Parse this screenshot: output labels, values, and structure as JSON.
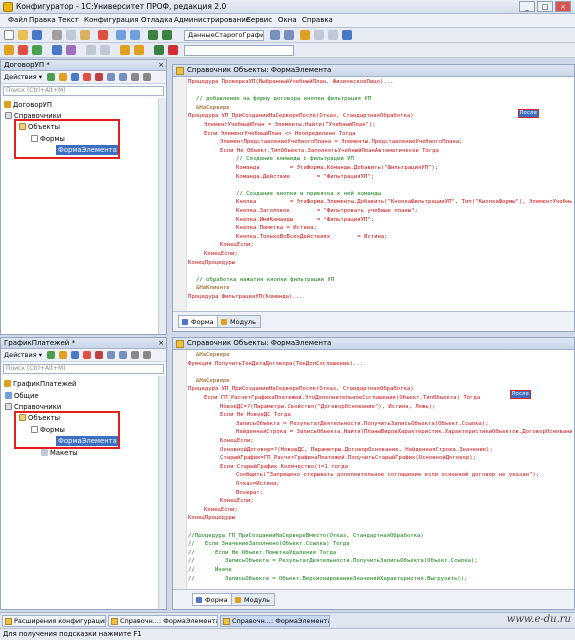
{
  "window": {
    "title": "Конфигуратор - 1С:Университет ПРОФ, редакция 2.0",
    "min": "_",
    "max": "□",
    "close": "×"
  },
  "menu": [
    "Файл",
    "Правка",
    "Текст",
    "Конфигурация",
    "Отладка",
    "Администрирование",
    "Сервис",
    "Окна",
    "Справка"
  ],
  "toolbar": {
    "combo_value": "ДанныеСтарогоГрафи",
    "combo2_value": ""
  },
  "panel1": {
    "title": "ДоговорУП *",
    "close": "×",
    "actions": "Действия ▾",
    "search_placeholder": "Поиск (Ctrl+Alt+M)",
    "tree": [
      "ДоговорУП",
      "Справочники",
      "Объекты",
      "Формы",
      "ФормаЭлемента"
    ]
  },
  "panel2": {
    "title": "ГрафикПлатежей *",
    "close": "×",
    "actions": "Действия ▾",
    "search_placeholder": "Поиск (Ctrl+Alt+M)",
    "tree": [
      "ГрафикПлатежей",
      "Общие",
      "Справочники",
      "Объекты",
      "Формы",
      "ФормаЭлемента",
      "Макеты"
    ]
  },
  "editor1": {
    "title": "Справочник Объекты: ФормаЭлемента",
    "tabs": [
      "Форма",
      "Модуль"
    ],
    "highlight": "После",
    "lines": [
      {
        "t": "Процедура ПроверкаУП(ВыбранныйУчебныйПлан, ФизическоеЛицо)...",
        "c": "kw",
        "x": 0
      },
      {
        "t": "",
        "c": "",
        "x": 0
      },
      {
        "t": "// добавление на форму договора кнопки фильтрация УП",
        "c": "cm",
        "x": 2
      },
      {
        "t": "&НаСервере",
        "c": "pp",
        "x": 2
      },
      {
        "t": "Процедура УП_ПриСозданииНаСервереПосле(Отказ, СтандартнаяОбработка)",
        "c": "kw",
        "x": 0
      },
      {
        "t": "ЭлементУчебныйПлан = Элементы.Найти(\"УчебныйПлан\");",
        "c": "kw",
        "x": 4
      },
      {
        "t": "Если ЭлементУчебныйПлан <> Неопределено Тогда",
        "c": "kw",
        "x": 4
      },
      {
        "t": "ЭлементПредставлениеУчебногоПлана = Элементы.ПредставлениеУчебногоПлана;",
        "c": "kw",
        "x": 8
      },
      {
        "t": "Если Не Объект.ТипОбъекта.ЗаполнятьУчебныйПланАвтоматически Тогда",
        "c": "kw",
        "x": 8
      },
      {
        "t": "// Создание команды с фильтрации УП",
        "c": "cm",
        "x": 12
      },
      {
        "t": "Команда         = ЭтаФорма.Команды.Добавить(\"ФильтрацияУП\");",
        "c": "kw",
        "x": 12
      },
      {
        "t": "Команда.Действие        = \"ФильтрацияУП\";",
        "c": "kw",
        "x": 12
      },
      {
        "t": "",
        "c": "",
        "x": 0
      },
      {
        "t": "// Создание кнопки и привязка к ней команды",
        "c": "cm",
        "x": 12
      },
      {
        "t": "Кнопка          = ЭтаФорма.Элементы.Добавить(\"КнопкаФильтрацииУП\", Тип(\"КнопкаФормы\"), ЭлементУчебныйПлан);",
        "c": "kw",
        "x": 12
      },
      {
        "t": "Кнопка.Заголовок        = \"Фильтровать учебные планы\";",
        "c": "kw",
        "x": 12
      },
      {
        "t": "Кнопка.ИмяКоманды       = \"ФильтрацияУП\";",
        "c": "kw",
        "x": 12
      },
      {
        "t": "Кнопка.Пометка = Истина;",
        "c": "kw",
        "x": 12
      },
      {
        "t": "Кнопка.ТолькоВоВсехДействиях        = Истина;",
        "c": "kw",
        "x": 12
      },
      {
        "t": "КонецЕсли;",
        "c": "kw",
        "x": 8
      },
      {
        "t": "КонецЕсли;",
        "c": "kw",
        "x": 4
      },
      {
        "t": "КонецПроцедуры",
        "c": "kw",
        "x": 0
      },
      {
        "t": "",
        "c": "",
        "x": 0
      },
      {
        "t": "// обработка нажатия кнопки фильтрации УП",
        "c": "cm",
        "x": 2
      },
      {
        "t": "&НаКлиенте",
        "c": "pp",
        "x": 2
      },
      {
        "t": "Процедура ФильтрацияУП(Команда)...",
        "c": "kw",
        "x": 0
      }
    ]
  },
  "editor2": {
    "title": "Справочник Объекты: ФормаЭлемента",
    "tabs": [
      "Форма",
      "Модуль"
    ],
    "highlight": "После",
    "lines": [
      {
        "t": "&НаСервере",
        "c": "pp",
        "x": 2
      },
      {
        "t": "Функция ПолучитьТекДатаДоговора(ТекДопСоглашение)...",
        "c": "kw",
        "x": 0
      },
      {
        "t": "",
        "c": "",
        "x": 0
      },
      {
        "t": "&НаСервере",
        "c": "pp",
        "x": 2
      },
      {
        "t": "Процедура УП_ПриСозданииНаСервереПосле(Отказ, СтандартнаяОбработка)",
        "c": "kw",
        "x": 0
      },
      {
        "t": "Если ГП_РасчетГрафикаПлатежей.ЭтоДополнительноеСоглашение(Объект.ТипОбъекта) Тогда",
        "c": "kw",
        "x": 4
      },
      {
        "t": "НовоеДС=?(Параметры.Свойство(\"ДоговорОснование\"), Истина, Ложь);",
        "c": "kw",
        "x": 8
      },
      {
        "t": "Если Не НовоеДС Тогда",
        "c": "kw",
        "x": 8
      },
      {
        "t": "ЗаписьОбъекта = РезультатДеятельности.ПолучитьЗаписьОбъекта(Объект.Ссылка);",
        "c": "kw",
        "x": 12
      },
      {
        "t": "НайденнаяСтрока = ЗаписьОбъекта.Найти(ПланыВидовХарактеристик.ХарактеристикиОбъектов.ДоговорОснование);",
        "c": "kw",
        "x": 12
      },
      {
        "t": "КонецЕсли;",
        "c": "kw",
        "x": 8
      },
      {
        "t": "ОсновнойДоговор=?(НовоеДС, Параметры.ДоговорОснование, НайденнаяСтрока.Значение);",
        "c": "kw",
        "x": 8
      },
      {
        "t": "СтарыйГрафик=ГП_РасчетГрафикаПлатежей.ПолучитьСтарыйГрафик(ОсновнойДоговор);",
        "c": "kw",
        "x": 8
      },
      {
        "t": "Если СтарыйГрафик.Количество()=1 тогда",
        "c": "kw",
        "x": 8
      },
      {
        "t": "Сообщить(\"Запрещено открывать дополнительное соглашение если основной договор не указан\");",
        "c": "kw",
        "x": 12
      },
      {
        "t": "Отказ=Истина;",
        "c": "kw",
        "x": 12
      },
      {
        "t": "Возврат;",
        "c": "kw",
        "x": 12
      },
      {
        "t": "КонецЕсли;",
        "c": "kw",
        "x": 8
      },
      {
        "t": "КонецЕсли;",
        "c": "kw",
        "x": 4
      },
      {
        "t": "КонецПроцедуры",
        "c": "kw",
        "x": 0
      },
      {
        "t": "",
        "c": "",
        "x": 0
      },
      {
        "t": "//Процедура ГП_ПриСозданииНаСервереВместо(Отказ, СтандартнаяОбработка)",
        "c": "cm",
        "x": 0
      },
      {
        "t": "//   Если ЗначениеЗаполнено(Объект.Ссылка) Тогда",
        "c": "cm",
        "x": 0
      },
      {
        "t": "//      Если Не Объект.ПометкаУдаления Тогда",
        "c": "cm",
        "x": 0
      },
      {
        "t": "//         ЗаписьОбъекта = РезультатДеятельности.ПолучитьЗаписьОбъекта(Объект.Ссылка);",
        "c": "cm",
        "x": 0
      },
      {
        "t": "//      Иначе",
        "c": "cm",
        "x": 0
      },
      {
        "t": "//         ЗаписьОбъекта = Объект.ВерсионированиеЗначенийХарактеристик.Выгрузить();",
        "c": "cm",
        "x": 0
      }
    ]
  },
  "taskbar": [
    "Расширения конфигурации",
    "Справочн...: ФормаЭлемента",
    "Справочн...: ФормаЭлемента"
  ],
  "status": "Для получения подсказки нажмите F1",
  "site": "www.e-du.ru",
  "colors": {
    "keyword": "#d01010",
    "comment": "#108010",
    "selection": "#3b6fc4",
    "annotation": "#e0201c"
  }
}
